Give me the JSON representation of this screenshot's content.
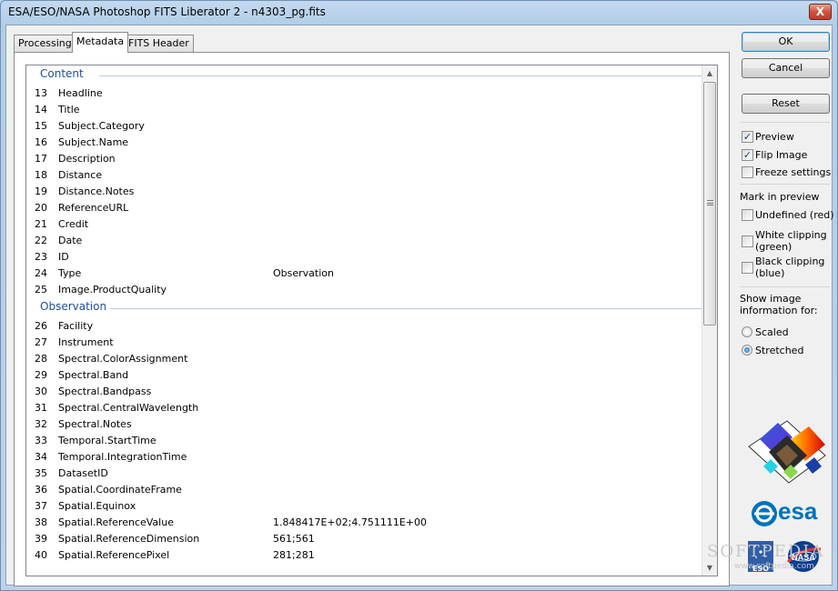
{
  "window": {
    "title": "ESA/ESO/NASA Photoshop FITS Liberator 2 - n4303_pg.fits",
    "close_glyph": "X"
  },
  "tabs": [
    {
      "label": "Processing",
      "active": false
    },
    {
      "label": "Metadata",
      "active": true
    },
    {
      "label": "FITS Header",
      "active": false
    }
  ],
  "sections": [
    {
      "title": "Content",
      "rows": [
        {
          "num": "13",
          "field": "Headline",
          "value": ""
        },
        {
          "num": "14",
          "field": "Title",
          "value": ""
        },
        {
          "num": "15",
          "field": "Subject.Category",
          "value": ""
        },
        {
          "num": "16",
          "field": "Subject.Name",
          "value": ""
        },
        {
          "num": "17",
          "field": "Description",
          "value": ""
        },
        {
          "num": "18",
          "field": "Distance",
          "value": ""
        },
        {
          "num": "19",
          "field": "Distance.Notes",
          "value": ""
        },
        {
          "num": "20",
          "field": "ReferenceURL",
          "value": ""
        },
        {
          "num": "21",
          "field": "Credit",
          "value": ""
        },
        {
          "num": "22",
          "field": "Date",
          "value": ""
        },
        {
          "num": "23",
          "field": "ID",
          "value": ""
        },
        {
          "num": "24",
          "field": "Type",
          "value": "Observation"
        },
        {
          "num": "25",
          "field": "Image.ProductQuality",
          "value": ""
        }
      ]
    },
    {
      "title": "Observation",
      "rows": [
        {
          "num": "26",
          "field": "Facility",
          "value": ""
        },
        {
          "num": "27",
          "field": "Instrument",
          "value": ""
        },
        {
          "num": "28",
          "field": "Spectral.ColorAssignment",
          "value": ""
        },
        {
          "num": "29",
          "field": "Spectral.Band",
          "value": ""
        },
        {
          "num": "30",
          "field": "Spectral.Bandpass",
          "value": ""
        },
        {
          "num": "31",
          "field": "Spectral.CentralWavelength",
          "value": ""
        },
        {
          "num": "32",
          "field": "Spectral.Notes",
          "value": ""
        },
        {
          "num": "33",
          "field": "Temporal.StartTime",
          "value": ""
        },
        {
          "num": "34",
          "field": "Temporal.IntegrationTime",
          "value": ""
        },
        {
          "num": "35",
          "field": "DatasetID",
          "value": ""
        },
        {
          "num": "36",
          "field": "Spatial.CoordinateFrame",
          "value": ""
        },
        {
          "num": "37",
          "field": "Spatial.Equinox",
          "value": ""
        },
        {
          "num": "38",
          "field": "Spatial.ReferenceValue",
          "value": "1.848417E+02;4.751111E+00"
        },
        {
          "num": "39",
          "field": "Spatial.ReferenceDimension",
          "value": "561;561"
        },
        {
          "num": "40",
          "field": "Spatial.ReferencePixel",
          "value": "281;281"
        }
      ]
    }
  ],
  "buttons": {
    "ok": "OK",
    "cancel": "Cancel",
    "reset": "Reset"
  },
  "options": {
    "preview": {
      "label": "Preview",
      "checked": true
    },
    "flip_image": {
      "label": "Flip Image",
      "checked": true
    },
    "freeze_settings": {
      "label": "Freeze settings",
      "checked": false
    }
  },
  "mark_in_preview": {
    "heading": "Mark in preview",
    "undefined": {
      "label": "Undefined (red)",
      "checked": false
    },
    "white_clipping": {
      "line1": "White clipping",
      "line2": "(green)",
      "checked": false
    },
    "black_clipping": {
      "line1": "Black clipping",
      "line2": "(blue)",
      "checked": false
    }
  },
  "show_info": {
    "line1": "Show image",
    "line2": "information for:",
    "scaled": {
      "label": "Scaled",
      "selected": false
    },
    "stretched": {
      "label": "Stretched",
      "selected": true
    }
  },
  "logos": {
    "esa": "esa",
    "eso": "ESO",
    "nasa": "NASA"
  },
  "watermark": {
    "text": "SOFTPEDIA",
    "sub": "www.softpedia.com"
  },
  "colors": {
    "section_header": "#1e4fa0",
    "esa_blue": "#0072bc",
    "nasa_red": "#e03c31"
  }
}
